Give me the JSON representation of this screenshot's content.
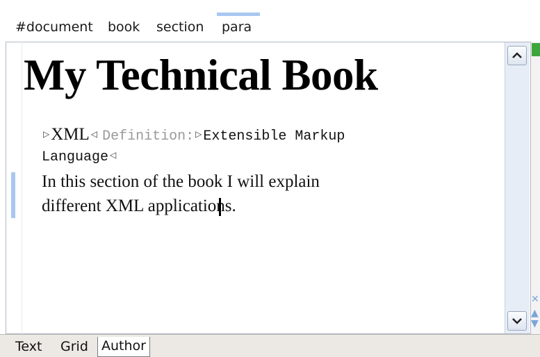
{
  "breadcrumb": [
    "#document",
    "book",
    "section",
    "para"
  ],
  "document": {
    "title": "My Technical Book",
    "term": "XML",
    "definition_label": "Definition:",
    "definition_text_1": "Extensible Markup",
    "definition_text_2": "Language",
    "paragraph_line_1": "In this section of the book I will explain",
    "paragraph_line_2": "different XML applications."
  },
  "tabs": [
    "Text",
    "Grid",
    "Author"
  ],
  "active_tab": "Author",
  "icons": {
    "open_marker": "tag-start-icon",
    "close_marker": "tag-end-icon",
    "scroll_up": "chevron-up-icon",
    "scroll_down": "chevron-down-icon",
    "status": "status-ok-icon"
  },
  "colors": {
    "selection": "#a9c8f0",
    "status_ok": "#3ca63c"
  }
}
